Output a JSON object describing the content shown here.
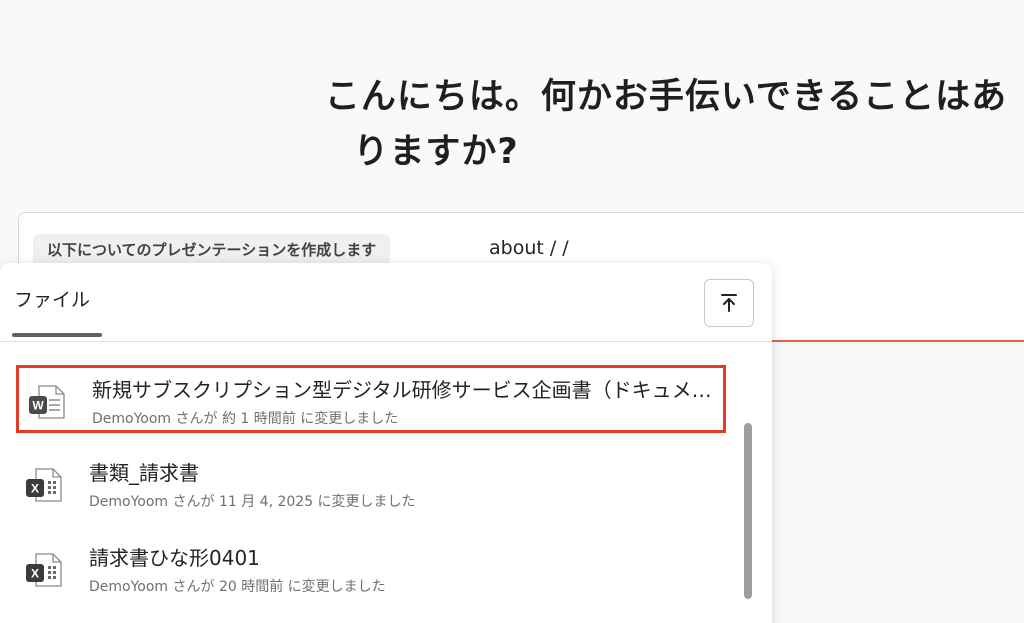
{
  "greeting": {
    "line1": "こんにちは。何かお手伝いできることはあ",
    "line2": "りますか?"
  },
  "prompt": {
    "chip_label": "以下についてのプレゼンテーションを作成します",
    "text": "about  / /"
  },
  "file_panel": {
    "tab_label": "ファイル",
    "upload_icon": "upload-icon",
    "files": [
      {
        "icon": "word-file-icon",
        "name": "新規サブスクリプション型デジタル研修サービス企画書（ドキュメント）",
        "meta": "DemoYoom さんが 約 1 時間前 に変更しました",
        "selected": true
      },
      {
        "icon": "excel-file-icon",
        "name": "書類_請求書",
        "meta": "DemoYoom さんが 11 月 4, 2025 に変更しました",
        "selected": false
      },
      {
        "icon": "excel-file-icon",
        "name": "請求書ひな形0401",
        "meta": "DemoYoom さんが 20 時間前 に変更しました",
        "selected": false
      }
    ]
  },
  "colors": {
    "accent_line": "#e0634a",
    "selection_border": "#e23b2a",
    "word_blue": "#185abd",
    "excel_dark": "#3c3c3c"
  }
}
